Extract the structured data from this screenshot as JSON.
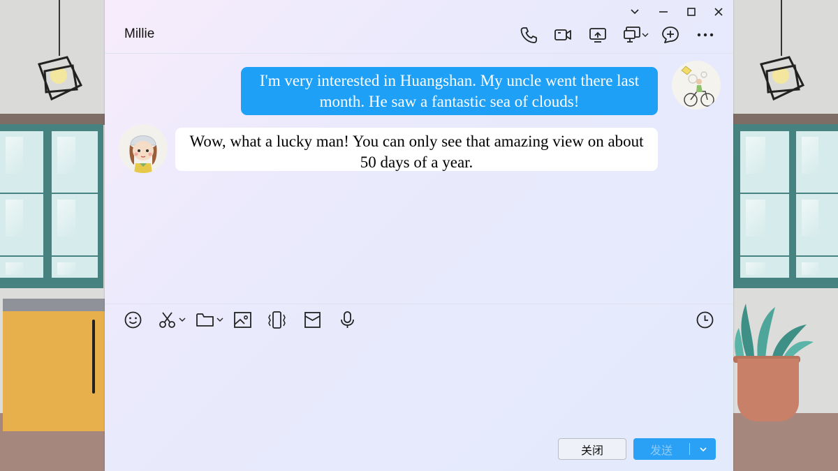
{
  "window": {
    "title": "Millie",
    "controls": [
      "chevron-down-icon",
      "minimize-icon",
      "maximize-icon",
      "close-icon"
    ]
  },
  "header_icons": [
    "phone-icon",
    "video-call-icon",
    "screen-share-icon",
    "remote-desktop-icon",
    "add-chat-icon",
    "more-icon"
  ],
  "messages": [
    {
      "sender": "me",
      "text": "I'm very interested in Huangshan. My uncle went there last month. He saw a fantastic sea of clouds!"
    },
    {
      "sender": "them",
      "text": "Wow, what a lucky man! You can only see that amazing view on about 50 days of a year."
    }
  ],
  "toolbar_icons": [
    "emoji-icon",
    "scissors-icon",
    "folder-icon",
    "image-icon",
    "shake-icon",
    "red-packet-icon",
    "microphone-icon",
    "history-icon"
  ],
  "buttons": {
    "close_label": "关闭",
    "send_label": "发送"
  },
  "colors": {
    "my_bubble": "#1da0f6",
    "their_bubble": "#ffffff",
    "send_button": "#2aa1f5"
  }
}
